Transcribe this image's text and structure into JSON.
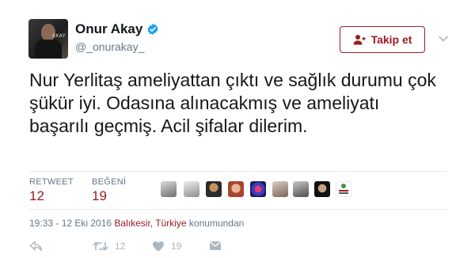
{
  "user": {
    "name": "Onur Akay",
    "handle": "@_onurakay_",
    "verified": true
  },
  "follow_button": {
    "label": "Takip et"
  },
  "tweet": {
    "text": "Nur Yerlitaş ameliyattan çıktı ve sağlık durumu çok şükür iyi. Odasına alınacakmış ve ameliyatı başarılı geçmiş. Acil şifalar dilerim."
  },
  "stats": {
    "retweet_label": "RETWEET",
    "retweet_count": "12",
    "like_label": "BEĞENİ",
    "like_count": "19"
  },
  "likers": [
    "liker-1",
    "liker-2",
    "liker-3",
    "liker-4",
    "liker-5",
    "liker-6",
    "liker-7",
    "liker-8",
    "liker-9"
  ],
  "meta": {
    "time": "19:33 - 12 Eki 2016",
    "location": "Balıkesir, Türkiye",
    "location_suffix": "konumundan"
  },
  "actions": {
    "retweet_count": "12",
    "like_count": "19"
  },
  "colors": {
    "accent": "#9a1c23",
    "verified": "#1da1f2",
    "muted": "#657786",
    "icon": "#aab8c2"
  }
}
